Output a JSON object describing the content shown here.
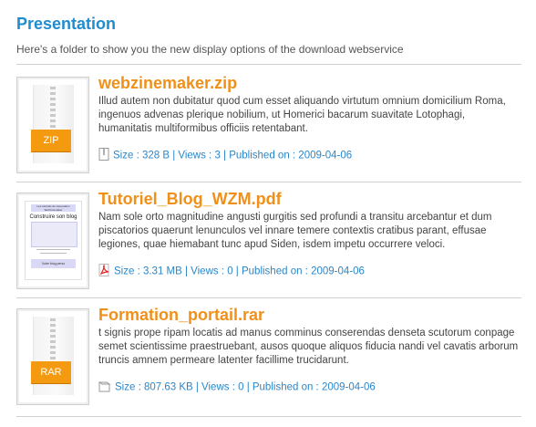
{
  "header": {
    "title": "Presentation",
    "intro": "Here's a folder to show you the new display options of the download webservice"
  },
  "files": [
    {
      "name": "webzinemaker.zip",
      "thumb_badge": "ZIP",
      "description": "Illud autem non dubitatur quod cum esset aliquando virtutum omnium domicilium Roma, ingenuos advenas plerique nobilium, ut Homerici bacarum suavitate Lotophagi, humanitatis multiformibus officiis retentabant.",
      "meta": "Size : 328 B | Views : 3 | Published on : 2009-04-06"
    },
    {
      "name": "Tutoriel_Blog_WZM.pdf",
      "thumb_pdf": {
        "header": "Les tutoriels de Generation Webzinemaker",
        "title": "Construire son blog",
        "footer": "Votre blog perso"
      },
      "description": "Nam sole orto magnitudine angusti gurgitis sed profundi a transitu arcebantur et dum piscatorios quaerunt lenunculos vel innare temere contextis cratibus parant, effusae legiones, quae hiemabant tunc apud Siden, isdem impetu occurrere veloci.",
      "meta": "Size : 3.31 MB | Views : 0 | Published on : 2009-04-06"
    },
    {
      "name": "Formation_portail.rar",
      "thumb_badge": "RAR",
      "description": "t signis prope ripam locatis ad manus comminus conserendas denseta scutorum conpage semet scientissime praestruebant, ausos quoque aliquos fiducia nandi vel cavatis arborum truncis amnem permeare latenter facillime trucidarunt.",
      "meta": "Size : 807.63 KB | Views : 0 | Published on : 2009-04-06"
    }
  ]
}
